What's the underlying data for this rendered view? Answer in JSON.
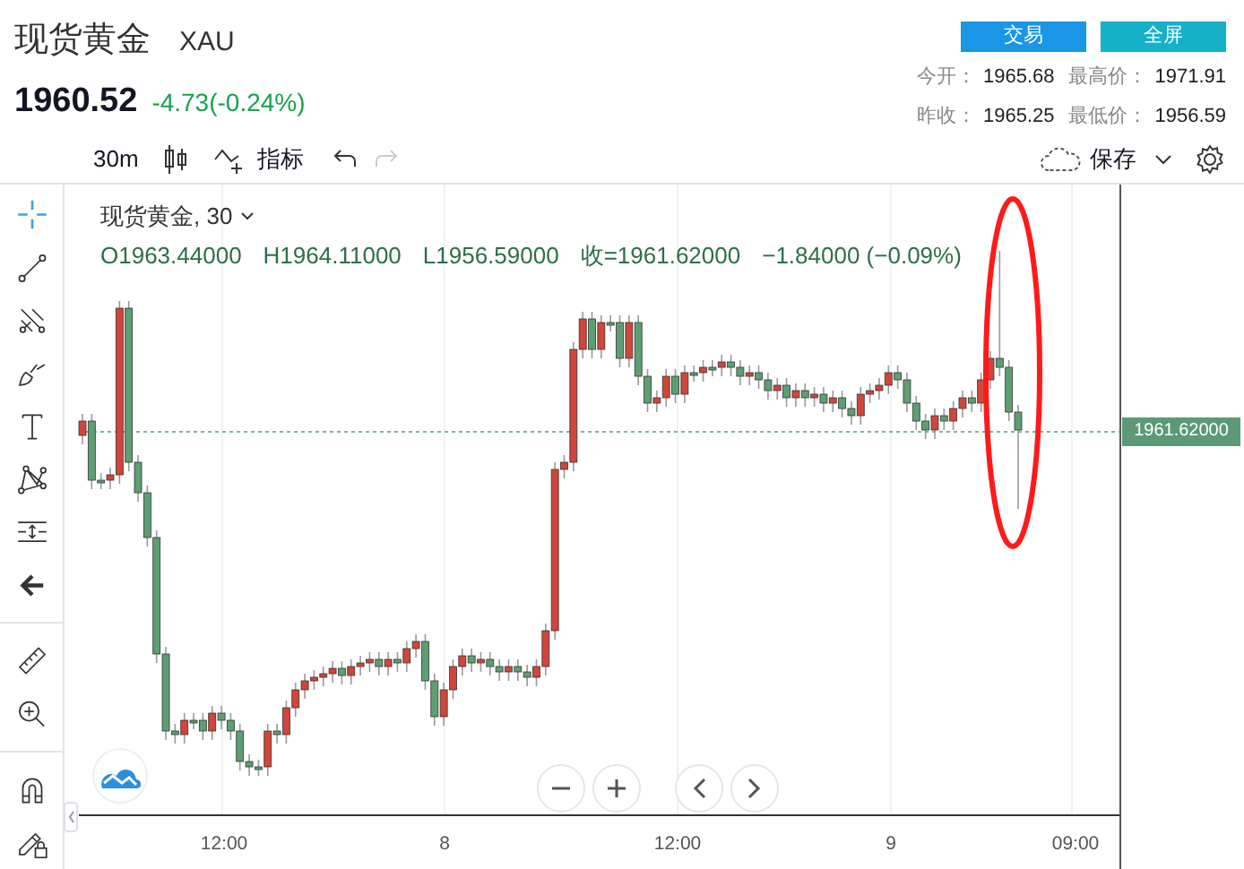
{
  "header": {
    "name": "现货黄金",
    "symbol": "XAU",
    "price": "1960.52",
    "change": "-4.73(-0.24%)",
    "buttons": [
      {
        "label": "交易",
        "kind": "trade"
      },
      {
        "label": "全屏",
        "kind": "fullscreen"
      }
    ],
    "stats": [
      {
        "label": "今开：",
        "value": "1965.68"
      },
      {
        "label": "最高价：",
        "value": "1971.91"
      },
      {
        "label": "昨收：",
        "value": "1965.25"
      },
      {
        "label": "最低价：",
        "value": "1956.59"
      }
    ]
  },
  "toolbar": {
    "interval": "30m",
    "indicators": "指标",
    "undo_disabled": false,
    "redo_disabled": true,
    "save": "保存"
  },
  "drawing_tools": [
    {
      "kind": "crosshair",
      "selected": true
    },
    {
      "kind": "line",
      "selected": false
    },
    {
      "kind": "fork",
      "selected": false
    },
    {
      "kind": "brush",
      "selected": false
    },
    {
      "kind": "text",
      "selected": false
    },
    {
      "kind": "pattern",
      "selected": false
    },
    {
      "kind": "measure",
      "selected": false
    },
    {
      "kind": "back",
      "selected": false
    },
    {
      "kind": "ruler",
      "selected": false
    },
    {
      "kind": "zoom",
      "selected": false
    },
    {
      "kind": "magnet",
      "selected": false
    },
    {
      "kind": "lock",
      "selected": false
    }
  ],
  "chart": {
    "legend_title": "现货黄金, 30",
    "ohlc": [
      "O1963.44000",
      "H1964.11000",
      "L1956.59000",
      "收=1961.62000",
      "−1.84000 (−0.09%)"
    ],
    "last_price": "1961.62000",
    "time_labels": [
      "12:00",
      "8",
      "12:00",
      "9",
      "09:00"
    ]
  }
}
